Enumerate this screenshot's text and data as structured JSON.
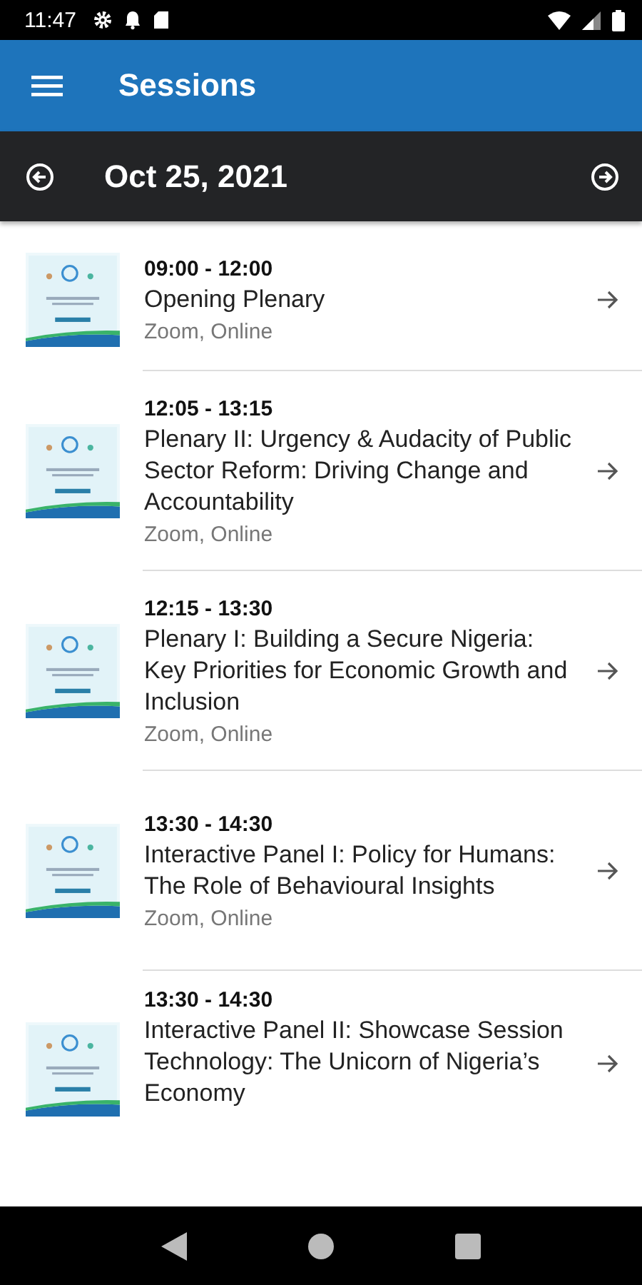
{
  "status_bar": {
    "time": "11:47"
  },
  "app_bar": {
    "title": "Sessions"
  },
  "date_bar": {
    "date": "Oct 25, 2021"
  },
  "sessions": [
    {
      "time": "09:00 - 12:00",
      "title": "Opening Plenary",
      "location": "Zoom, Online"
    },
    {
      "time": "12:05 - 13:15",
      "title": "Plenary II: Urgency & Audacity of Public Sector Reform: Driving Change and Accountability",
      "location": "Zoom, Online"
    },
    {
      "time": "12:15 - 13:30",
      "title": "Plenary I: Building a Secure Nigeria: Key Priorities for Economic Growth and Inclusion",
      "location": "Zoom, Online"
    },
    {
      "time": "13:30 - 14:30",
      "title": "Interactive Panel I: Policy for Humans: The Role of Behavioural Insights",
      "location": "Zoom, Online"
    },
    {
      "time": "13:30 - 14:30",
      "title": "Interactive Panel II: Showcase Session Technology: The Unicorn of Nigeria’s Economy"
    }
  ]
}
